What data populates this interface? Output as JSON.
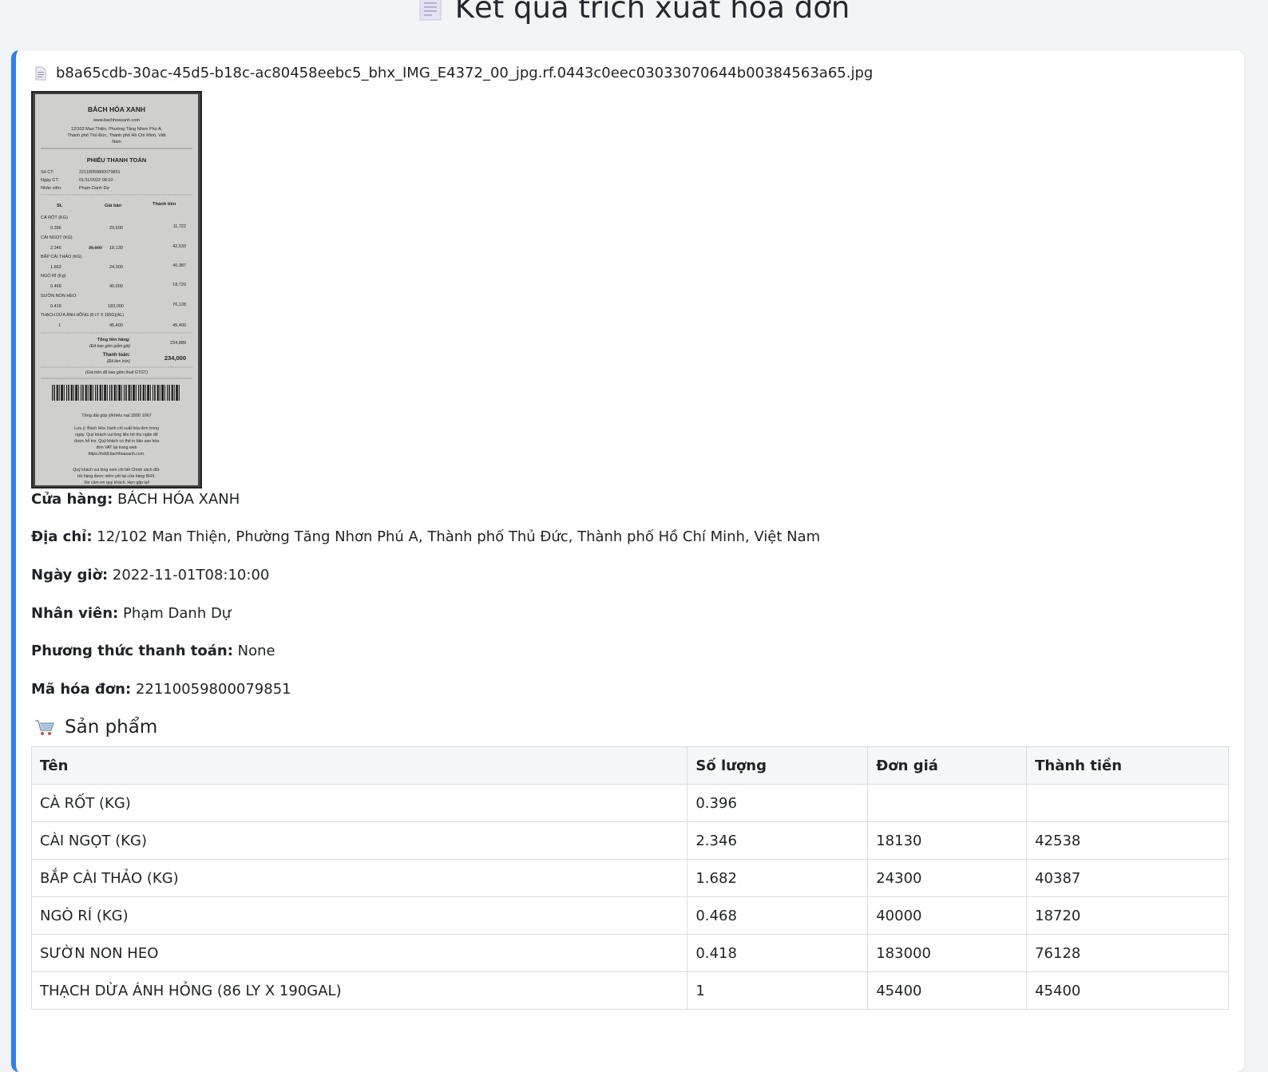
{
  "page": {
    "title": "Kết quả trích xuất hóa đơn",
    "title_icon": "document-icon"
  },
  "file": {
    "name": "b8a65cdb-30ac-45d5-b18c-ac80458eebc5_bhx_IMG_E4372_00_jpg.rf.0443c0eec03033070644b00384563a65.jpg",
    "icon": "file-icon"
  },
  "receipt_image": {
    "store": "BÁCH HÓA XANH",
    "website": "www.bachhoaxanh.com",
    "address_1": "12/102 Man Thiện, Phường Tăng Nhơn Phú A,",
    "address_2": "Thành phố Thủ Đức, Thành phố Hồ Chí Minh, Việt",
    "address_3": "Nam",
    "doc_title": "PHIẾU THANH TOÁN",
    "so_ct_label": "Số CT:",
    "so_ct": "22110059800079851",
    "ngay_ct_label": "Ngày CT:",
    "ngay_ct": "01/11/2022 08:10",
    "nhan_vien_label": "Nhân viên:",
    "nhan_vien": "Phạm Danh Dự",
    "col_sl": "SL",
    "col_gia": "Giá bán",
    "col_tt": "Thành tiền",
    "lines": [
      {
        "name": "CÀ RỐT (KG)",
        "qty": "0.396",
        "price": "29,600",
        "total": "11,722",
        "old": ""
      },
      {
        "name": "CẢI NGỌT (KG)",
        "qty": "2.346",
        "price": "18,130",
        "total": "42,533",
        "old": "25,900"
      },
      {
        "name": "BẮP CẢI THẢO (KG)",
        "qty": "1.662",
        "price": "24,300",
        "total": "40,387",
        "old": ""
      },
      {
        "name": "NGÒ RÍ (Kg)",
        "qty": "0.468",
        "price": "40,000",
        "total": "18,720",
        "old": ""
      },
      {
        "name": "SƯỜN NON HEO",
        "qty": "0.416",
        "price": "183,000",
        "total": "76,128",
        "old": ""
      },
      {
        "name": "THẠCH DỪA ÁNH HỒNG (8 LY X 190G)(AL)",
        "qty": "1",
        "price": "45,400",
        "total": "45,400",
        "old": ""
      }
    ],
    "tong_label": "Tổng tiền hàng:",
    "tong_note": "(Đã bao gồm giảm giá)",
    "tong": "234,889",
    "tt_label": "Thanh toán:",
    "tt_note": "(Đã làm tròn)",
    "tt": "234,000",
    "vat_note": "(Giá trên đã bao gồm thuế GTGT)",
    "hotline": "Tổng đài góp ý/khiếu nại:1800 1067",
    "note_1": "Lưu ý: Bách Hóa Xanh chỉ xuất hóa đơn trong",
    "note_2": "ngày. Quý khách vui lòng liên hệ thu ngân để",
    "note_3": "được hỗ trợ. Quý khách có thể in bản sao hóa",
    "note_4": "đơn VAT tại trang web",
    "note_5": "https://hddt.bachhoaxanh.com.",
    "note_6": "Quý khách vui lòng xem chi tiết Chính sách đổi-",
    "note_7": "trả hàng được niêm yết tại cửa hàng BHX.",
    "note_8": "Xin cảm ơn quý khách. Hẹn gặp lại!"
  },
  "info": {
    "store_label": "Cửa hàng:",
    "store_value": "BÁCH HÓA XANH",
    "address_label": "Địa chỉ:",
    "address_value": "12/102 Man Thiện, Phường Tăng Nhơn Phú A, Thành phố Thủ Đức, Thành phố Hồ Chí Minh, Việt Nam",
    "datetime_label": "Ngày giờ:",
    "datetime_value": "2022-11-01T08:10:00",
    "staff_label": "Nhân viên:",
    "staff_value": "Phạm Danh Dự",
    "payment_label": "Phương thức thanh toán:",
    "payment_value": "None",
    "invoice_label": "Mã hóa đơn:",
    "invoice_value": "22110059800079851"
  },
  "products": {
    "title": "Sản phẩm",
    "icon": "cart-icon",
    "headers": [
      "Tên",
      "Số lượng",
      "Đơn giá",
      "Thành tiền"
    ],
    "rows": [
      [
        "CÀ RỐT (KG)",
        "0.396",
        "",
        ""
      ],
      [
        "CÀI NGỌT (KG)",
        "2.346",
        "18130",
        "42538"
      ],
      [
        "BẮP CÀI THẢO (KG)",
        "1.682",
        "24300",
        "40387"
      ],
      [
        "NGÒ RÍ (KG)",
        "0.468",
        "40000",
        "18720"
      ],
      [
        "SƯỜN NON HEO",
        "0.418",
        "183000",
        "76128"
      ],
      [
        "THẠCH DỪA ÁNH HỎNG (86 LY X 190GAL)",
        "1",
        "45400",
        "45400"
      ]
    ]
  },
  "colors": {
    "accent": "#2f80ed",
    "background": "#f3f4f6",
    "card": "#ffffff"
  }
}
